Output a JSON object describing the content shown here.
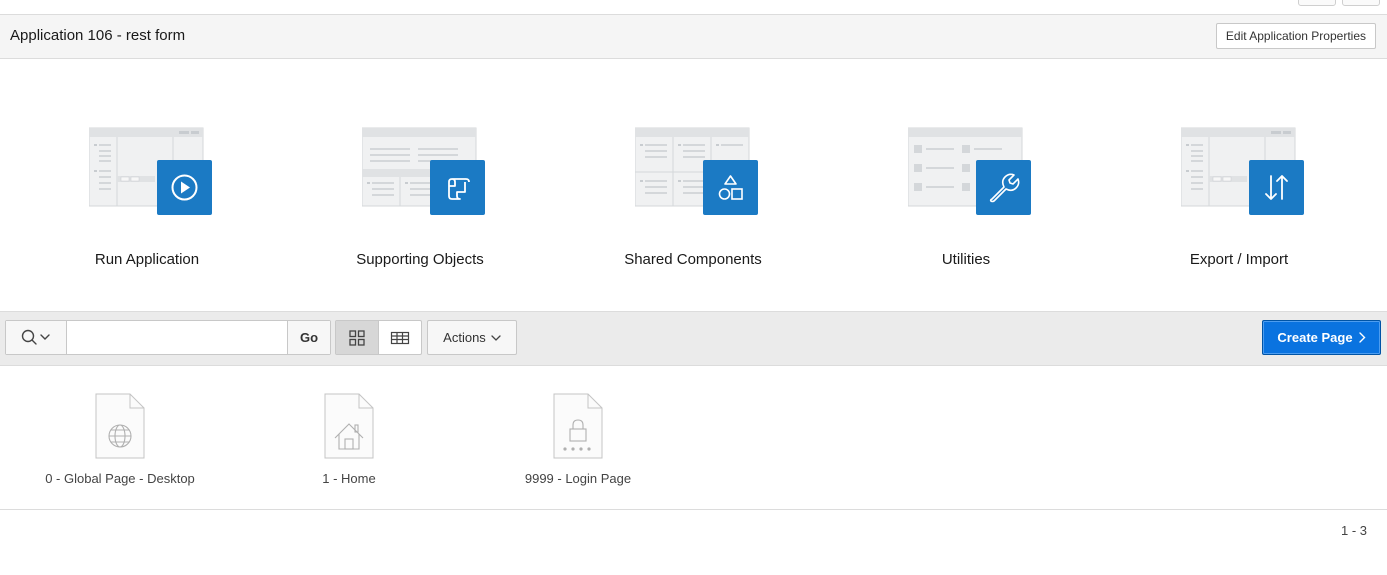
{
  "header": {
    "title": "Application 106 - rest form",
    "edit_button": "Edit Application Properties"
  },
  "tiles": [
    {
      "label": "Run Application",
      "icon": "play-icon"
    },
    {
      "label": "Supporting Objects",
      "icon": "scroll-icon"
    },
    {
      "label": "Shared Components",
      "icon": "shapes-icon"
    },
    {
      "label": "Utilities",
      "icon": "wrench-icon"
    },
    {
      "label": "Export / Import",
      "icon": "arrows-up-down-icon"
    }
  ],
  "toolbar": {
    "search_placeholder": "",
    "go_label": "Go",
    "actions_label": "Actions",
    "create_label": "Create Page",
    "active_view": "icons"
  },
  "pages": [
    {
      "label": "0 - Global Page - Desktop",
      "icon": "globe-icon"
    },
    {
      "label": "1 - Home",
      "icon": "home-icon"
    },
    {
      "label": "9999 - Login Page",
      "icon": "lock-icon"
    }
  ],
  "pagination": "1 - 3",
  "colors": {
    "accent": "#1b7ac4",
    "primary_button": "#0a73e0",
    "illustration_gray": "#e6e8ea"
  }
}
